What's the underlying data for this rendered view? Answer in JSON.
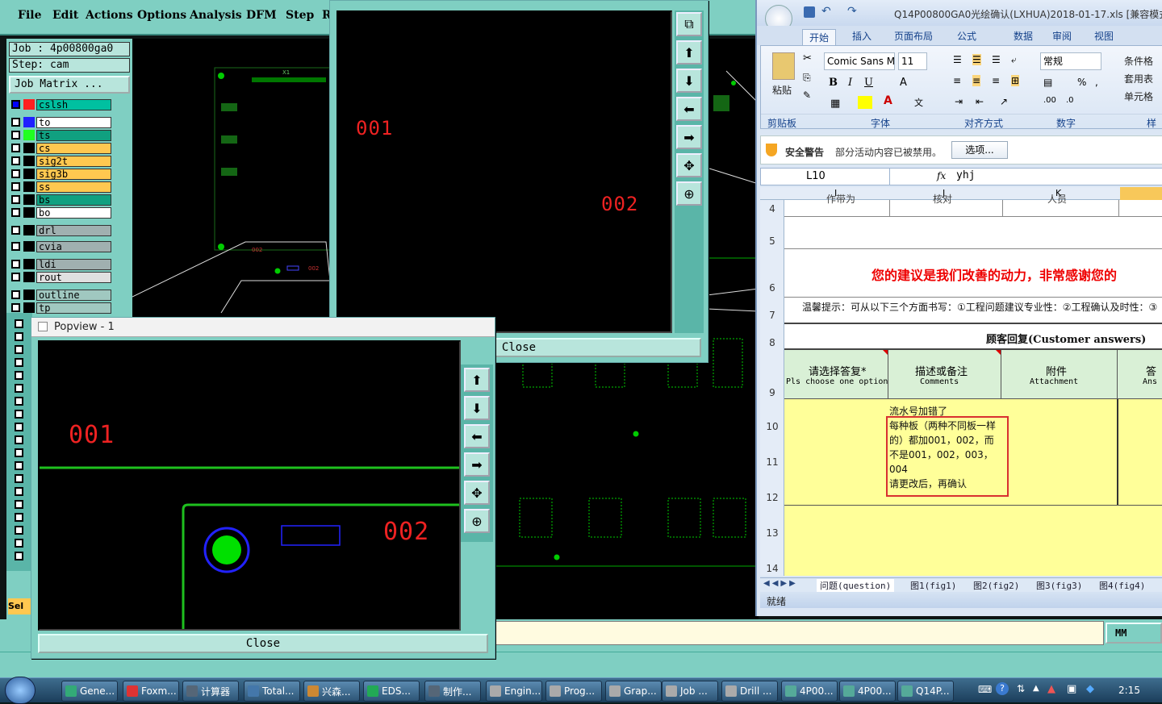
{
  "genesis": {
    "menu": [
      "File",
      "Edit",
      "Actions",
      "Options",
      "Analysis",
      "DFM",
      "Step",
      "R"
    ],
    "job_label": "Job : 4p00800ga0",
    "step_label": "Step: cam",
    "job_matrix_button": "Job Matrix ...",
    "layers": [
      {
        "name": "cslsh",
        "color": "#00c0a0"
      },
      {
        "name": "to",
        "color": "#ffffff"
      },
      {
        "name": "ts",
        "color": "#10a080"
      },
      {
        "name": "cs",
        "color": "#ffc850"
      },
      {
        "name": "sig2t",
        "color": "#ffc850"
      },
      {
        "name": "sig3b",
        "color": "#ffc850"
      },
      {
        "name": "ss",
        "color": "#ffc850"
      },
      {
        "name": "bs",
        "color": "#10a080"
      },
      {
        "name": "bo",
        "color": "#ffffff"
      },
      {
        "name": "drl",
        "color": "#a0b0b0"
      },
      {
        "name": "cvia",
        "color": "#a0b0b0"
      },
      {
        "name": "ldi",
        "color": "#a0b0b0"
      },
      {
        "name": "rout",
        "color": "#e0e0e0"
      },
      {
        "name": "outline",
        "color": "#a0c8c0"
      },
      {
        "name": "tp",
        "color": "#a0c8c0"
      }
    ],
    "sel_label": "Sel",
    "units": "MM",
    "pcb_marks": [
      "X1",
      "002",
      "002"
    ]
  },
  "popview_top": {
    "label_a": "001",
    "label_b": "002",
    "close": "Close"
  },
  "popview1": {
    "title": "Popview - 1",
    "label_a": "001",
    "label_b": "002",
    "close": "Close"
  },
  "excel": {
    "title": "Q14P00800GA0光绘确认(LXHUA)2018-01-17.xls [兼容模式]",
    "tabs": [
      "开始",
      "插入",
      "页面布局",
      "公式",
      "数据",
      "审阅",
      "视图"
    ],
    "font_name": "Comic Sans M",
    "font_size": "11",
    "number_format": "常规",
    "groups": [
      "剪贴板",
      "字体",
      "对齐方式",
      "数字",
      "样"
    ],
    "paste": "粘贴",
    "cond_format": "条件格",
    "table_format": "套用表",
    "cell_style": "单元格",
    "security_title": "安全警告",
    "security_msg": "部分活动内容已被禁用。",
    "security_btn": "选项...",
    "name_box": "L10",
    "fx": "fx",
    "formula": "yhj",
    "col_headers": [
      "I",
      "J",
      "K"
    ],
    "row4_i": "作带为",
    "row4_j": "核对",
    "row4_k": "人员",
    "banner": "您的建议是我们改善的动力，非常感谢您的",
    "tip": "温馨提示：可从以下三个方面书写：①工程问题建议专业性：②工程确认及时性：③",
    "customer_answers": "顾客回复(Customer answers)",
    "hdr1_cn": "请选择答复*",
    "hdr1_en": "Pls choose one option",
    "hdr2_cn": "描述或备注",
    "hdr2_en": "Comments",
    "hdr3_cn": "附件",
    "hdr3_en": "Attachment",
    "hdr4_cn": "答",
    "hdr4_en": "Ans",
    "comment_lines": [
      "流水号加错了",
      "每种板（两种不同板一样",
      "的）都加001，002，而",
      "不是001，002，003，",
      "004",
      "请更改后，再确认"
    ],
    "row_numbers": [
      "4",
      "5",
      "6",
      "7",
      "8",
      "9",
      "10",
      "11",
      "12",
      "13",
      "14"
    ],
    "sheets": [
      "问题(question)",
      "图1(fig1)",
      "图2(fig2)",
      "图3(fig3)",
      "图4(fig4)"
    ],
    "status": "就绪"
  },
  "taskbar": {
    "items": [
      "Gene...",
      "Foxm...",
      "计算器",
      "Total...",
      "兴森...",
      "EDS...",
      "制作...",
      "Engin...",
      "Prog...",
      "Grap...",
      "Job ...",
      "Drill ...",
      "4P00...",
      "4P00...",
      "Q14P..."
    ],
    "clock": "2:15"
  }
}
